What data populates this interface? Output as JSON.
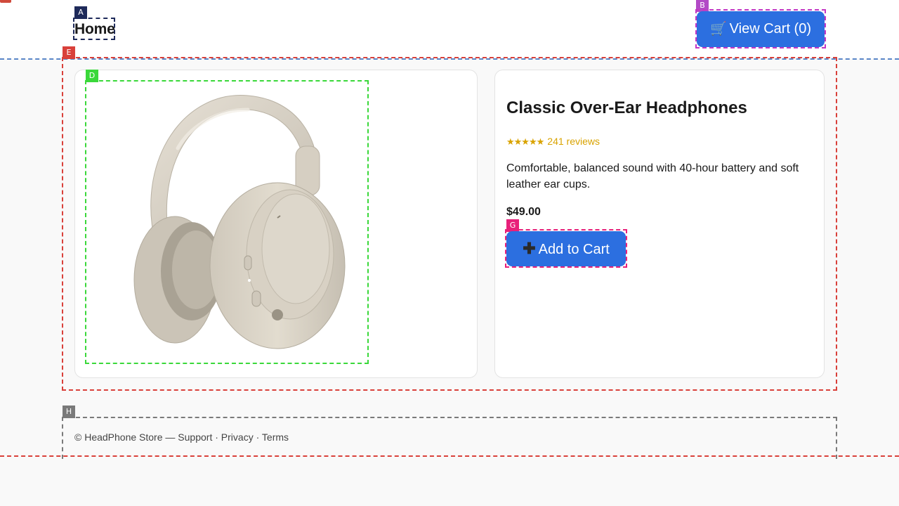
{
  "annotations": {
    "A": {
      "label": "A",
      "color": "#1e2a5a"
    },
    "B": {
      "label": "B",
      "color": "#b24ac6"
    },
    "D": {
      "label": "D",
      "color": "#3ad83a"
    },
    "E": {
      "label": "E",
      "color": "#d9403a"
    },
    "G": {
      "label": "G",
      "color": "#e8207a"
    },
    "H": {
      "label": "H",
      "color": "#7a7a7a"
    }
  },
  "header": {
    "home_label": "Home",
    "cart_icon": "shopping-cart-icon",
    "cart_label": "View Cart (0)"
  },
  "product": {
    "image_alt": "Classic Over-Ear Headphones",
    "title": "Classic Over-Ear Headphones",
    "stars": "★★★★★",
    "rating": 5,
    "reviews": "241 reviews",
    "description": "Comfortable, balanced sound with 40-hour battery and soft leather ear cups.",
    "price": "$49.00",
    "add_icon": "plus-icon",
    "add_label": "Add to Cart"
  },
  "footer": {
    "prefix": "© HeadPhone Store — ",
    "links": [
      "Support",
      "Privacy",
      "Terms"
    ],
    "separator": " · "
  },
  "colors": {
    "accent": "#2c6fe0",
    "star": "#d9a300",
    "page_bg": "#f9f9f9",
    "headphone_body": "#dcd6cb"
  }
}
